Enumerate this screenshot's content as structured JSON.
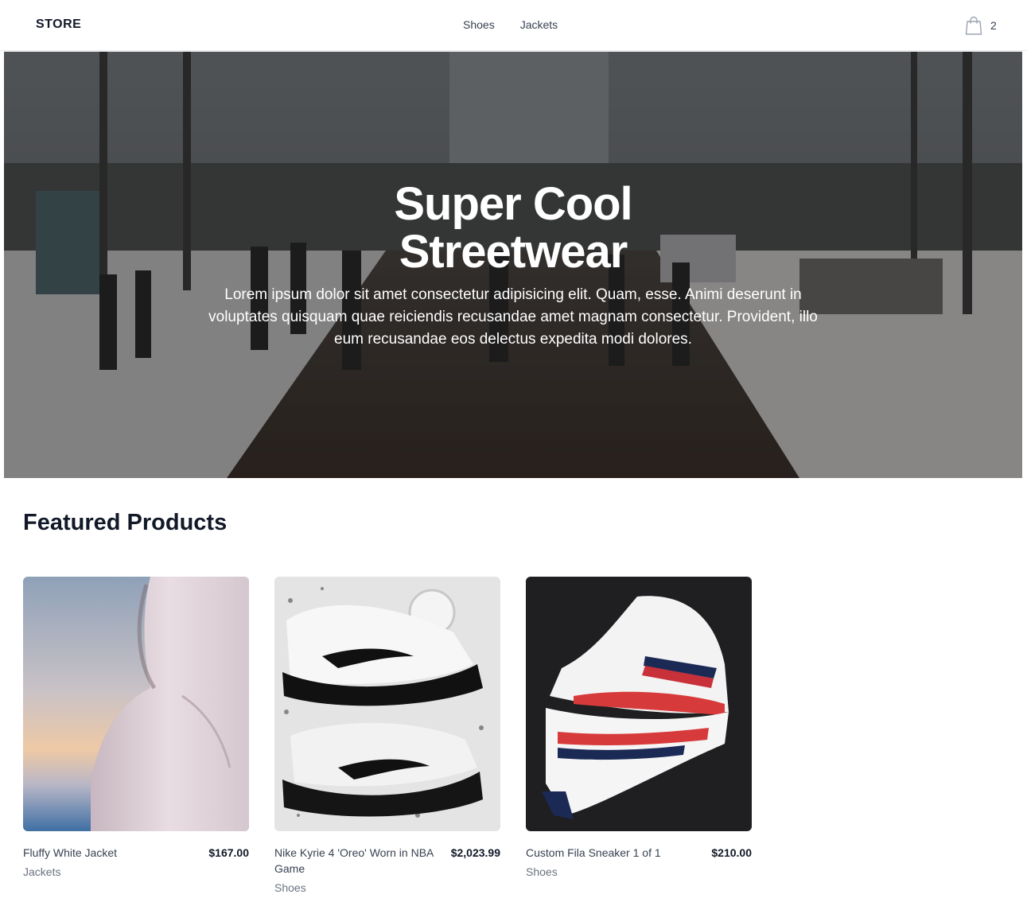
{
  "nav": {
    "brand": "STORE",
    "links": [
      {
        "label": "Shoes"
      },
      {
        "label": "Jackets"
      }
    ],
    "cart_icon": "shopping-bag-icon",
    "cart_count": "2"
  },
  "hero": {
    "title_line1": "Super Cool",
    "title_line2": "Streetwear",
    "description": "Lorem ipsum dolor sit amet consectetur adipisicing elit. Quam, esse. Animi deserunt in voluptates quisquam quae reiciendis recusandae amet magnam consectetur. Provident, illo eum recusandae eos delectus expedita modi dolores."
  },
  "featured": {
    "title": "Featured Products",
    "products": [
      {
        "name": "Fluffy White Jacket",
        "price": "$167.00",
        "category": "Jackets"
      },
      {
        "name": "Nike Kyrie 4 'Oreo' Worn in NBA Game",
        "price": "$2,023.99",
        "category": "Shoes"
      },
      {
        "name": "Custom Fila Sneaker 1 of 1",
        "price": "$210.00",
        "category": "Shoes"
      }
    ]
  },
  "colors": {
    "text_primary": "#111827",
    "text_muted": "#6b7280",
    "border": "#e5e7eb"
  }
}
